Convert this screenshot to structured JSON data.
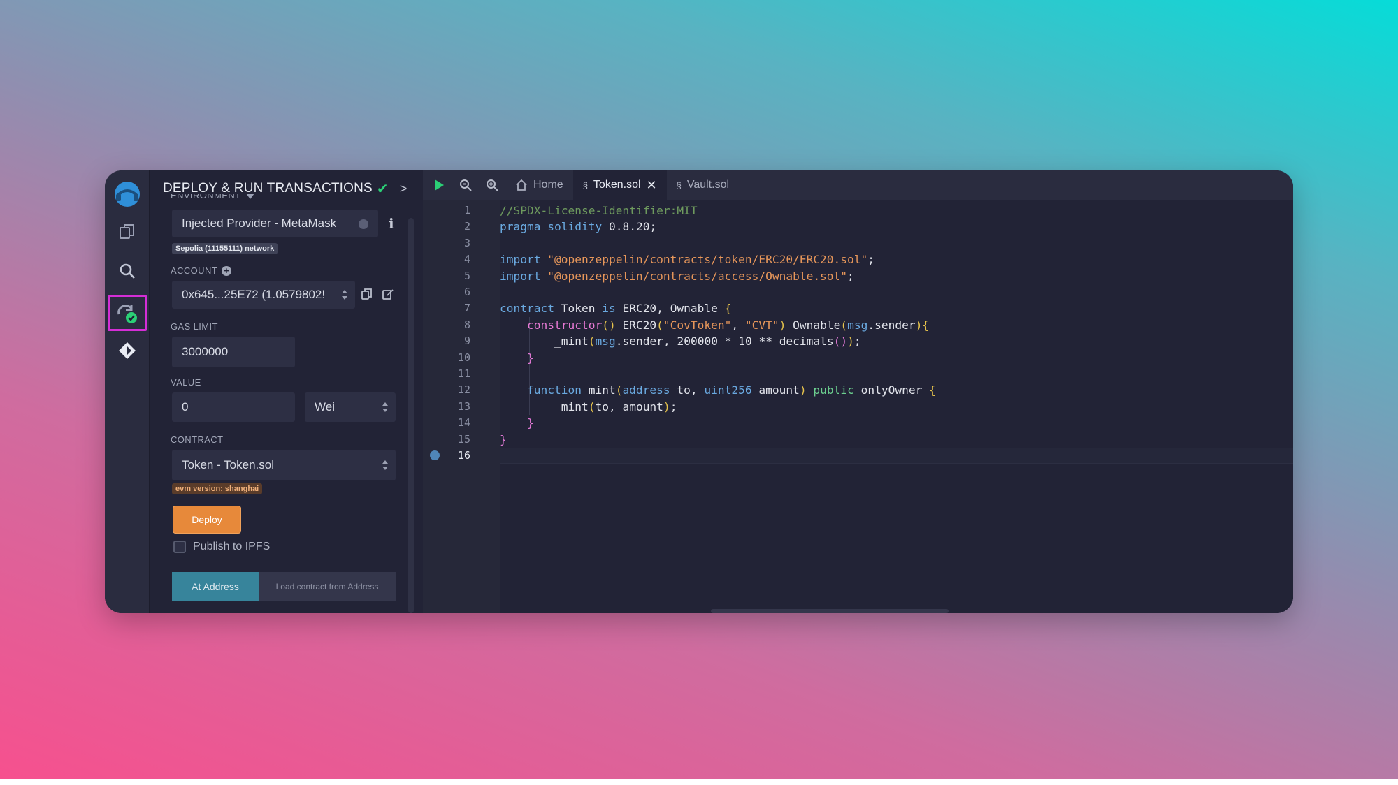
{
  "panel": {
    "title": "DEPLOY & RUN TRANSACTIONS",
    "environment_label": "ENVIRONMENT",
    "environment_value": "Injected Provider - MetaMask",
    "network_badge": "Sepolia (11155111) network",
    "account_label": "ACCOUNT",
    "account_value": "0x645...25E72 (1.0579802!",
    "gas_limit_label": "GAS LIMIT",
    "gas_limit_value": "3000000",
    "value_label": "VALUE",
    "value_amount": "0",
    "value_unit": "Wei",
    "contract_label": "CONTRACT",
    "contract_value": "Token - Token.sol",
    "evm_badge": "evm version: shanghai",
    "deploy_label": "Deploy",
    "publish_label": "Publish to IPFS",
    "at_address_label": "At Address",
    "load_contract_placeholder": "Load contract from Address"
  },
  "tabs": [
    {
      "label": "Home"
    },
    {
      "label": "Token.sol"
    },
    {
      "label": "Vault.sol"
    }
  ],
  "code": {
    "line_numbers": [
      "1",
      "2",
      "3",
      "4",
      "5",
      "6",
      "7",
      "8",
      "9",
      "10",
      "11",
      "12",
      "13",
      "14",
      "15",
      "16"
    ],
    "lines": [
      "//SPDX-License-Identifier:MIT",
      "pragma solidity 0.8.20;",
      "",
      "import \"@openzeppelin/contracts/token/ERC20/ERC20.sol\";",
      "import \"@openzeppelin/contracts/access/Ownable.sol\";",
      "",
      "contract Token is ERC20, Ownable {",
      "    constructor() ERC20(\"CovToken\", \"CVT\") Ownable(msg.sender){",
      "        _mint(msg.sender, 200000 * 10 ** decimals());",
      "    }",
      "",
      "    function mint(address to, uint256 amount) public onlyOwner {",
      "        _mint(to, amount);",
      "    }",
      "}",
      ""
    ]
  },
  "colors": {
    "accent_active_border": "#d42ed6",
    "deploy_button": "#e7893a",
    "at_address_button": "#37849b",
    "check_green": "#2bd076"
  }
}
